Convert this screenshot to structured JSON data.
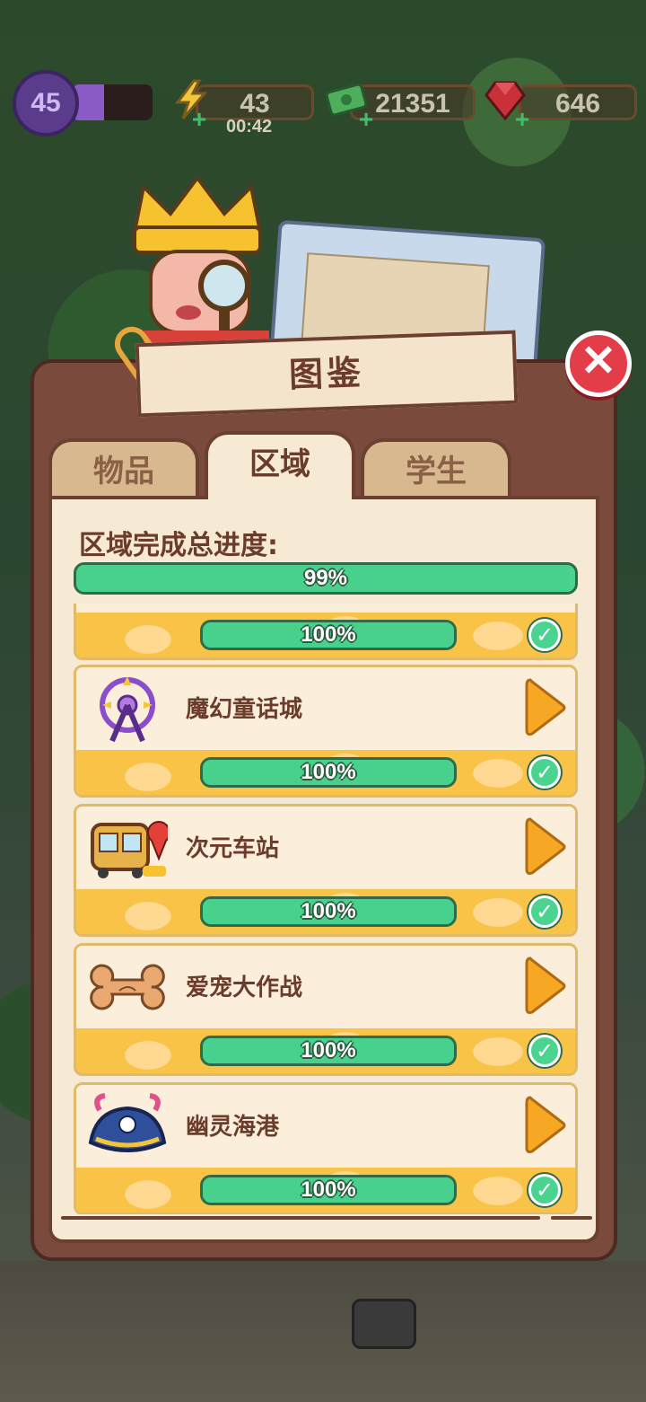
{
  "hud": {
    "level": "45",
    "level_progress": 0.4,
    "energy": "43",
    "energy_timer": "00:42",
    "cash": "21351",
    "gems": "646",
    "icons": [
      "level-badge-icon",
      "lightning-icon",
      "cash-icon",
      "ruby-icon"
    ]
  },
  "panel": {
    "title": "图鉴",
    "tabs": [
      {
        "label": "物品",
        "active": false
      },
      {
        "label": "区域",
        "active": true
      },
      {
        "label": "学生",
        "active": false
      }
    ],
    "total_label": "区域完成总进度:",
    "total_progress": "99%",
    "total_progress_value": 0.99
  },
  "areas": [
    {
      "name": "",
      "progress": "100%",
      "progress_value": 1.0,
      "icon": "area-icon",
      "partial": true
    },
    {
      "name": "魔幻童话城",
      "progress": "100%",
      "progress_value": 1.0,
      "icon": "ferris-wheel-icon"
    },
    {
      "name": "次元车站",
      "progress": "100%",
      "progress_value": 1.0,
      "icon": "train-icon"
    },
    {
      "name": "爱宠大作战",
      "progress": "100%",
      "progress_value": 1.0,
      "icon": "bone-icon"
    },
    {
      "name": "幽灵海港",
      "progress": "100%",
      "progress_value": 1.0,
      "icon": "pirate-hat-icon"
    }
  ],
  "colors": {
    "panel_brown": "#7a4a3c",
    "cream": "#f6ead4",
    "progress_green": "#48d18c",
    "accent_orange": "#f6a724",
    "close_red": "#e23d48"
  }
}
